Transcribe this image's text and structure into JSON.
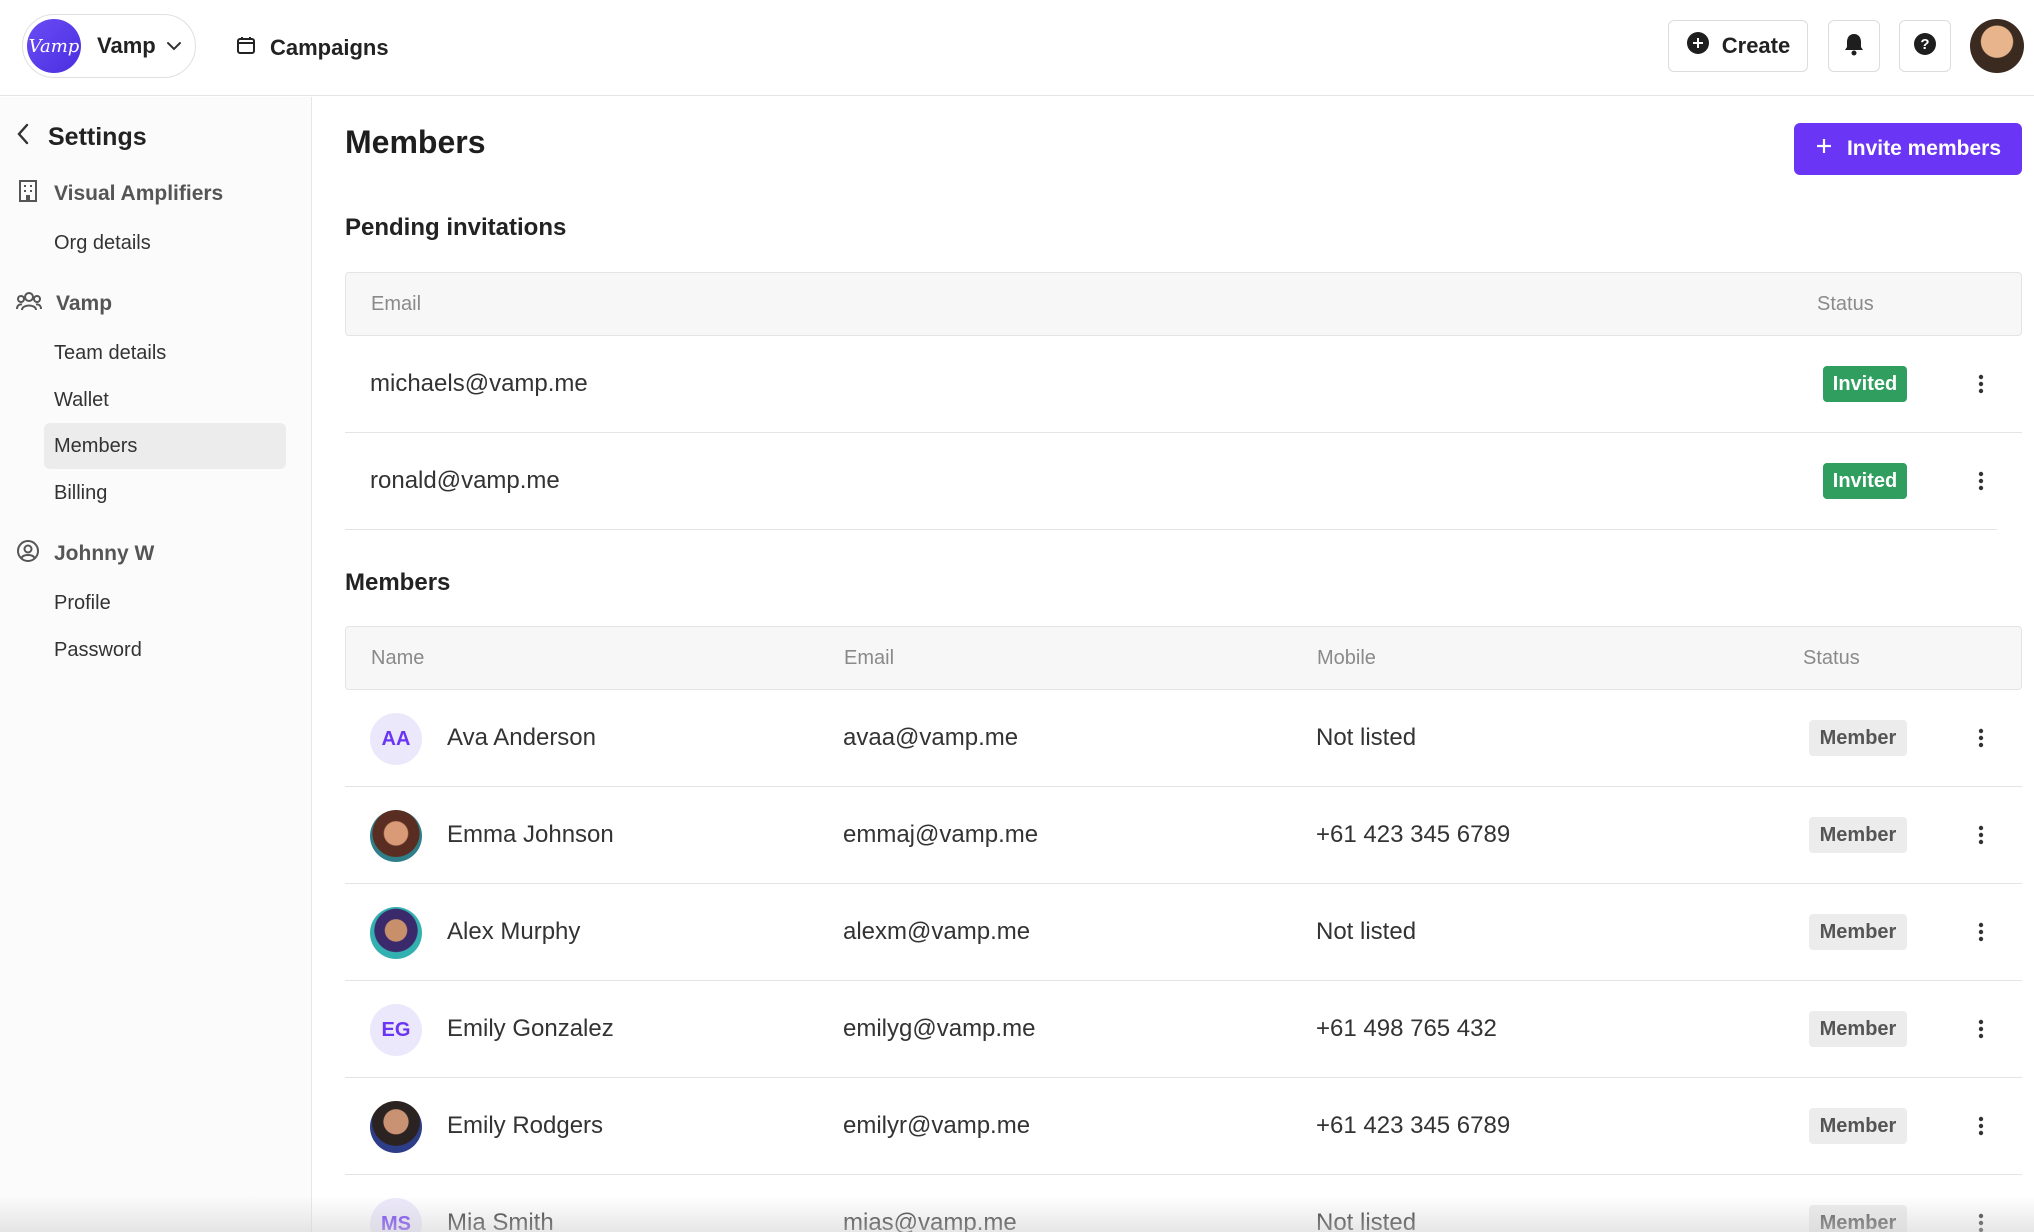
{
  "topbar": {
    "logo_text": "Vamp",
    "team_name": "Vamp",
    "campaigns_label": "Campaigns",
    "create_label": "Create"
  },
  "sidebar": {
    "settings_label": "Settings",
    "sections": [
      {
        "title": "Visual Amplifiers",
        "icon": "building-icon",
        "items": [
          "Org details"
        ]
      },
      {
        "title": "Vamp",
        "icon": "team-icon",
        "items": [
          "Team details",
          "Wallet",
          "Members",
          "Billing"
        ]
      },
      {
        "title": "Johnny W",
        "icon": "user-circle-icon",
        "items": [
          "Profile",
          "Password"
        ]
      }
    ],
    "active_item": "Members"
  },
  "main": {
    "title": "Members",
    "invite_label": "Invite members",
    "pending": {
      "title": "Pending invitations",
      "columns": {
        "email": "Email",
        "status": "Status"
      },
      "rows": [
        {
          "email": "michaels@vamp.me",
          "status": "Invited"
        },
        {
          "email": "ronald@vamp.me",
          "status": "Invited"
        }
      ]
    },
    "members": {
      "title": "Members",
      "columns": {
        "name": "Name",
        "email": "Email",
        "mobile": "Mobile",
        "status": "Status"
      },
      "rows": [
        {
          "initials": "AA",
          "name": "Ava Anderson",
          "email": "avaa@vamp.me",
          "mobile": "Not listed",
          "status": "Member"
        },
        {
          "initials": "",
          "name": "Emma Johnson",
          "email": "emmaj@vamp.me",
          "mobile": "+61 423 345 6789",
          "status": "Member"
        },
        {
          "initials": "",
          "name": "Alex Murphy",
          "email": "alexm@vamp.me",
          "mobile": "Not listed",
          "status": "Member"
        },
        {
          "initials": "EG",
          "name": "Emily Gonzalez",
          "email": "emilyg@vamp.me",
          "mobile": "+61 498 765 432",
          "status": "Member"
        },
        {
          "initials": "",
          "name": "Emily Rodgers",
          "email": "emilyr@vamp.me",
          "mobile": "+61 423 345 6789",
          "status": "Member"
        },
        {
          "initials": "MS",
          "name": "Mia Smith",
          "email": "mias@vamp.me",
          "mobile": "Not listed",
          "status": "Member"
        }
      ]
    }
  },
  "colors": {
    "accent": "#6a35f5",
    "invited": "#2f9e5f",
    "member_badge": "#ececec"
  }
}
